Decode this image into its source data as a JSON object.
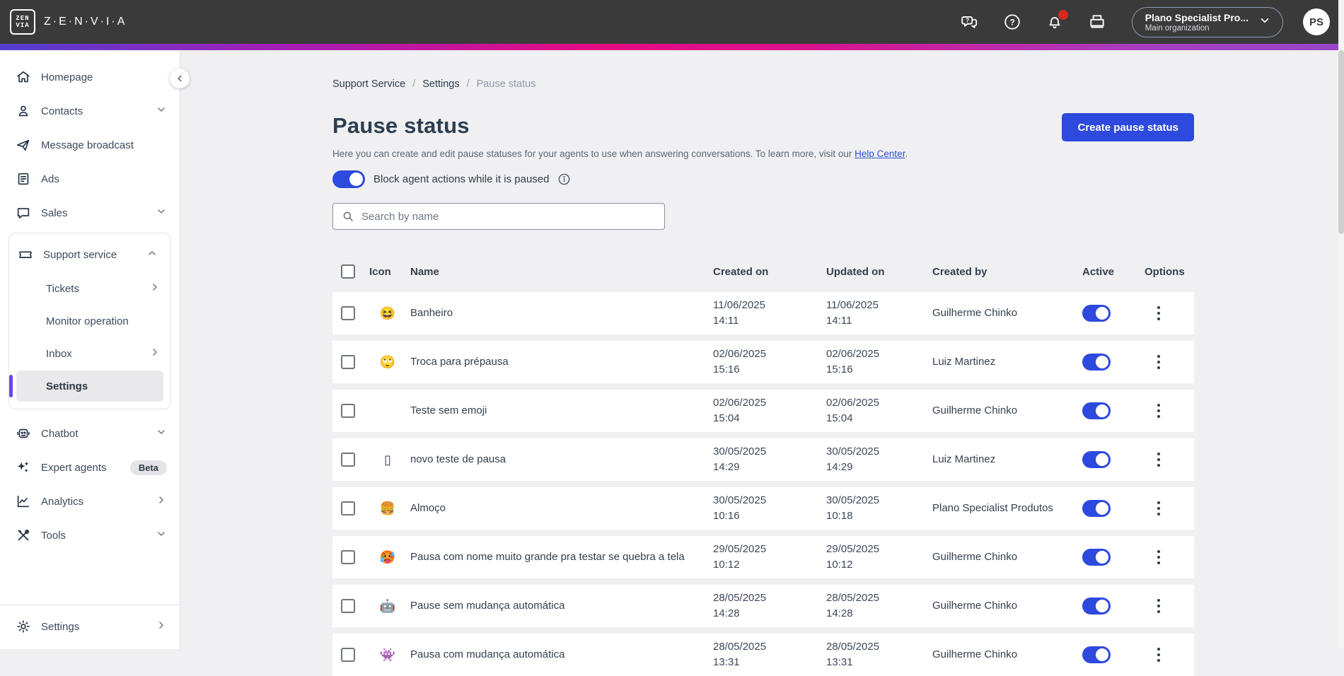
{
  "topbar": {
    "brand": "Z·E·N·V·I·A",
    "logo_top": "ZEN",
    "logo_bottom": "VIA",
    "org_name": "Plano Specialist Pro...",
    "org_sub": "Main organization",
    "avatar": "PS",
    "icon_names": [
      "chat-help-icon",
      "help-icon",
      "notifications-icon",
      "workspace-icon"
    ]
  },
  "colors": {
    "topbar_bg": "#3a3a3a",
    "accent_blue": "#2e49dd",
    "active_purple": "#6b46ee",
    "gradient": [
      "#5240cf",
      "#e60b82",
      "#9747c9"
    ],
    "page_bg": "#f0f0f2",
    "link_blue": "#2b50d8",
    "notification_red": "#d7291e"
  },
  "sidebar": {
    "homepage": "Homepage",
    "contacts": "Contacts",
    "message_broadcast": "Message broadcast",
    "ads": "Ads",
    "sales": "Sales",
    "support_service": "Support service",
    "tickets": "Tickets",
    "monitor_operation": "Monitor operation",
    "inbox": "Inbox",
    "settings": "Settings",
    "chatbot": "Chatbot",
    "expert_agents": "Expert agents",
    "beta": "Beta",
    "analytics": "Analytics",
    "tools": "Tools",
    "bottom_settings": "Settings"
  },
  "breadcrumb": {
    "items": [
      "Support Service",
      "Settings",
      "Pause status"
    ]
  },
  "page": {
    "title": "Pause status",
    "desc_prefix": "Here you can create and edit pause statuses for your agents to use when answering conversations. To learn more, visit our ",
    "desc_link": "Help Center",
    "desc_suffix": ".",
    "create_button": "Create pause status",
    "block_toggle_label": "Block agent actions while it is paused",
    "block_toggle_on": true,
    "search_placeholder": "Search by name"
  },
  "table": {
    "headers": [
      "Icon",
      "Name",
      "Created on",
      "Updated on",
      "Created by",
      "Active",
      "Options"
    ],
    "rows": [
      {
        "icon": "😆",
        "name": "Banheiro",
        "created_date": "11/06/2025",
        "created_time": "14:11",
        "updated_date": "11/06/2025",
        "updated_time": "14:11",
        "created_by": "Guilherme Chinko",
        "active": true
      },
      {
        "icon": "🙄",
        "name": "Troca para prépausa",
        "created_date": "02/06/2025",
        "created_time": "15:16",
        "updated_date": "02/06/2025",
        "updated_time": "15:16",
        "created_by": "Luiz Martinez",
        "active": true
      },
      {
        "icon": "",
        "name": "Teste sem emoji",
        "created_date": "02/06/2025",
        "created_time": "15:04",
        "updated_date": "02/06/2025",
        "updated_time": "15:04",
        "created_by": "Guilherme Chinko",
        "active": true
      },
      {
        "icon": "▯",
        "name": "novo teste de pausa",
        "created_date": "30/05/2025",
        "created_time": "14:29",
        "updated_date": "30/05/2025",
        "updated_time": "14:29",
        "created_by": "Luiz Martinez",
        "active": true
      },
      {
        "icon": "🍔",
        "name": "Almoço",
        "created_date": "30/05/2025",
        "created_time": "10:16",
        "updated_date": "30/05/2025",
        "updated_time": "10:18",
        "created_by": "Plano Specialist Produtos",
        "active": true
      },
      {
        "icon": "🥵",
        "name": "Pausa com nome muito grande pra testar se quebra a tela",
        "created_date": "29/05/2025",
        "created_time": "10:12",
        "updated_date": "29/05/2025",
        "updated_time": "10:12",
        "created_by": "Guilherme Chinko",
        "active": true
      },
      {
        "icon": "🤖",
        "name": "Pause sem mudança automática",
        "created_date": "28/05/2025",
        "created_time": "14:28",
        "updated_date": "28/05/2025",
        "updated_time": "14:28",
        "created_by": "Guilherme Chinko",
        "active": true
      },
      {
        "icon": "👾",
        "name": "Pausa com mudança automática",
        "created_date": "28/05/2025",
        "created_time": "13:31",
        "updated_date": "28/05/2025",
        "updated_time": "13:31",
        "created_by": "Guilherme Chinko",
        "active": true
      }
    ]
  }
}
